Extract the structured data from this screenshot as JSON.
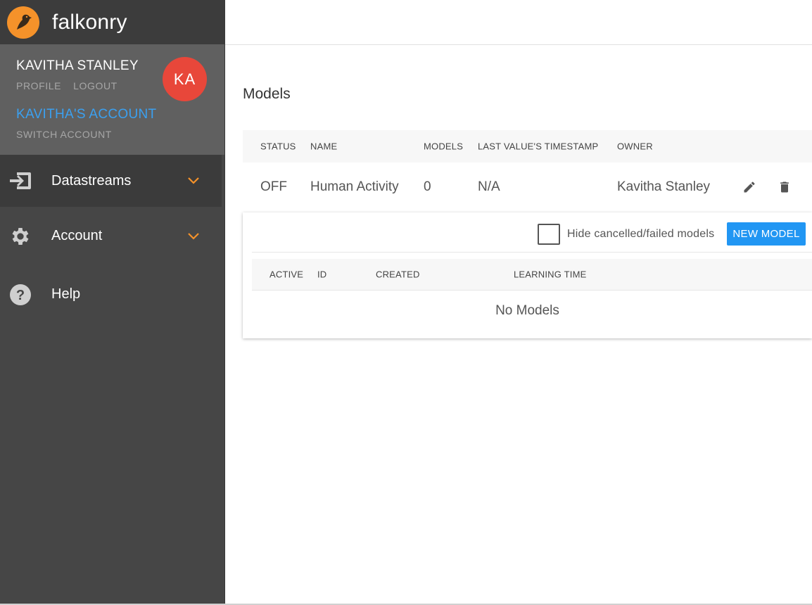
{
  "brand": {
    "name": "falkonry",
    "logo_icon": "falcon-logo-icon",
    "logo_color": "#f5922a"
  },
  "user": {
    "name": "KAVITHA STANLEY",
    "initials": "KA",
    "avatar_color": "#e8473a",
    "profile_label": "PROFILE",
    "logout_label": "LOGOUT",
    "account_name": "KAVITHA'S ACCOUNT",
    "switch_account_label": "SWITCH ACCOUNT"
  },
  "nav": {
    "datastreams": {
      "label": "Datastreams",
      "icon": "datastream-input-icon",
      "expanded_icon": "chevron-down-icon"
    },
    "account": {
      "label": "Account",
      "icon": "gear-icon",
      "expanded_icon": "chevron-down-icon"
    },
    "help": {
      "label": "Help",
      "icon": "help-icon"
    }
  },
  "accent_color": "#f5922a",
  "page": {
    "title": "Models"
  },
  "datastream_table": {
    "headers": {
      "status": "STATUS",
      "name": "NAME",
      "models": "MODELS",
      "timestamp": "LAST VALUE'S TIMESTAMP",
      "owner": "OWNER"
    },
    "rows": [
      {
        "status": "OFF",
        "name": "Human Activity",
        "models": "0",
        "timestamp": "N/A",
        "owner": "Kavitha Stanley"
      }
    ]
  },
  "models_panel": {
    "hide_label": "Hide cancelled/failed models",
    "hide_checked": false,
    "new_model_label": "NEW MODEL",
    "new_model_color": "#2196f3",
    "headers": {
      "active": "ACTIVE",
      "id": "ID",
      "created": "CREATED",
      "learning_time": "LEARNING TIME"
    },
    "empty_message": "No Models"
  }
}
